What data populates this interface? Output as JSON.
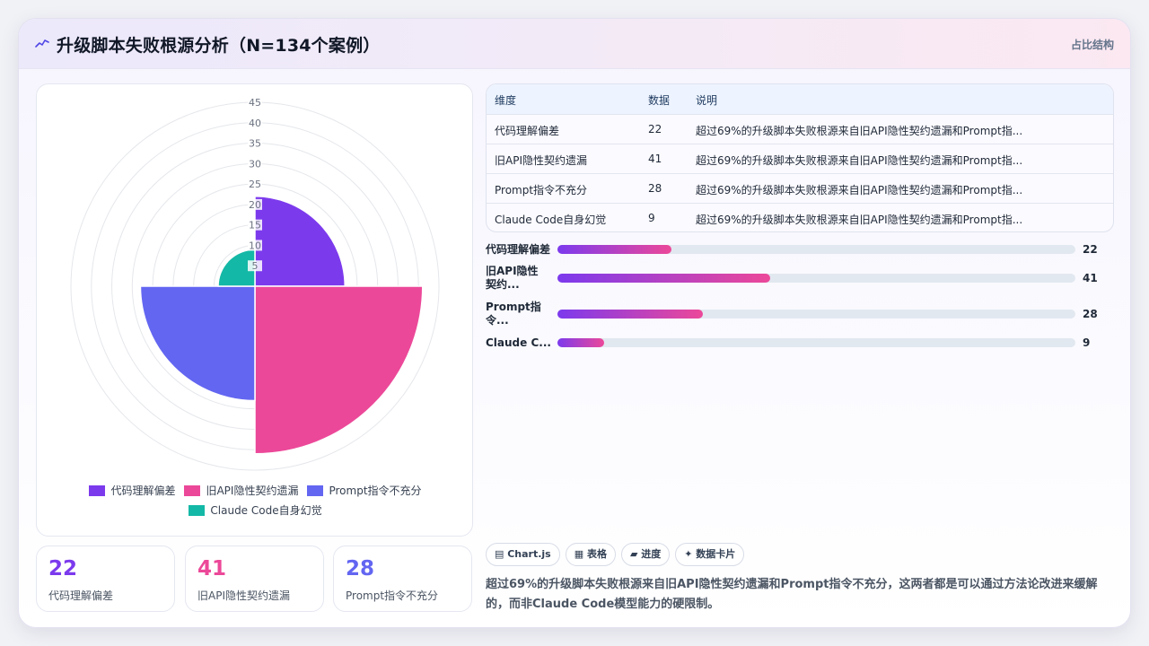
{
  "header": {
    "title": "升级脚本失败根源分析（N=134个案例）",
    "right_label": "占比结构"
  },
  "colors": {
    "purple": "#7c3aed",
    "pink": "#ec4899",
    "indigo": "#6366f1",
    "teal": "#14b8a6"
  },
  "chart_data": {
    "type": "polarArea",
    "title": "",
    "categories": [
      "代码理解偏差",
      "旧API隐性契约遗漏",
      "Prompt指令不充分",
      "Claude Code自身幻觉"
    ],
    "values": [
      22,
      41,
      28,
      9
    ],
    "colors": [
      "#7c3aed",
      "#ec4899",
      "#6366f1",
      "#14b8a6"
    ],
    "r_range": [
      0,
      45
    ],
    "ticks": [
      5,
      10,
      15,
      20,
      25,
      30,
      35,
      40,
      45
    ],
    "grid": true,
    "legend": "bottom"
  },
  "legend": [
    {
      "label": "代码理解偏差",
      "color": "#7c3aed"
    },
    {
      "label": "旧API隐性契约遗漏",
      "color": "#ec4899"
    },
    {
      "label": "Prompt指令不充分",
      "color": "#6366f1"
    },
    {
      "label": "Claude Code自身幻觉",
      "color": "#14b8a6"
    }
  ],
  "stats": [
    {
      "value": "22",
      "label": "代码理解偏差",
      "color": "#7c3aed"
    },
    {
      "value": "41",
      "label": "旧API隐性契约遗漏",
      "color": "#ec4899"
    },
    {
      "value": "28",
      "label": "Prompt指令不充分",
      "color": "#6366f1"
    }
  ],
  "table": {
    "headers": [
      "维度",
      "数据",
      "说明"
    ],
    "rows": [
      [
        "代码理解偏差",
        "22",
        "超过69%的升级脚本失败根源来自旧API隐性契约遗漏和Prompt指..."
      ],
      [
        "旧API隐性契约遗漏",
        "41",
        "超过69%的升级脚本失败根源来自旧API隐性契约遗漏和Prompt指..."
      ],
      [
        "Prompt指令不充分",
        "28",
        "超过69%的升级脚本失败根源来自旧API隐性契约遗漏和Prompt指..."
      ],
      [
        "Claude Code自身幻觉",
        "9",
        "超过69%的升级脚本失败根源来自旧API隐性契约遗漏和Prompt指..."
      ]
    ]
  },
  "progress": {
    "max": 100,
    "items": [
      {
        "label": "代码理解偏差",
        "value": 22
      },
      {
        "label": "旧API隐性契约...",
        "value": 41
      },
      {
        "label": "Prompt指令...",
        "value": 28
      },
      {
        "label": "Claude C...",
        "value": 9
      }
    ]
  },
  "chips": [
    "▤ Chart.js",
    "▦ 表格",
    "▰ 进度",
    "✦ 数据卡片"
  ],
  "summary": "超过69%的升级脚本失败根源来自旧API隐性契约遗漏和Prompt指令不充分，这两者都是可以通过方法论改进来缓解的，而非Claude Code模型能力的硬限制。"
}
